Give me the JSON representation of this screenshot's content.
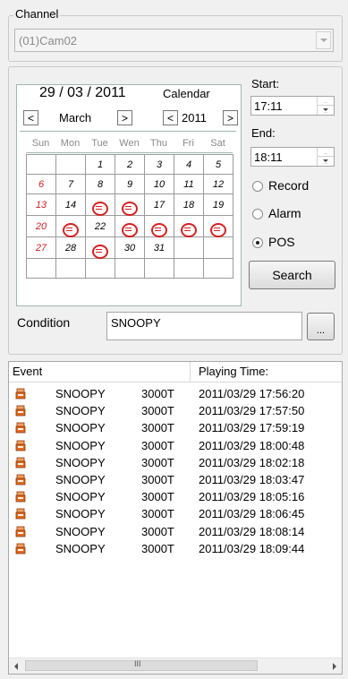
{
  "channel": {
    "legend": "Channel",
    "selected": "(01)Cam02"
  },
  "calendar": {
    "date_display": "29 / 03 / 2011",
    "calendar_label": "Calendar",
    "prev_month": "<",
    "next_month": ">",
    "month": "March",
    "prev_year": "<",
    "year": "2011",
    "next_year": ">",
    "weekdays": [
      "Sun",
      "Mon",
      "Tue",
      "Wen",
      "Thu",
      "Fri",
      "Sat"
    ],
    "weeks": [
      [
        "",
        "",
        "1",
        "2",
        "3",
        "4",
        "5"
      ],
      [
        "6",
        "7",
        "8",
        "9",
        "10",
        "11",
        "12"
      ],
      [
        "13",
        "14",
        "15",
        "16",
        "17",
        "18",
        "19"
      ],
      [
        "20",
        "21",
        "22",
        "23",
        "24",
        "25",
        "26"
      ],
      [
        "27",
        "28",
        "29",
        "30",
        "31",
        "",
        ""
      ],
      [
        "",
        "",
        "",
        "",
        "",
        "",
        ""
      ]
    ],
    "recorded_days": [
      "15",
      "16",
      "21",
      "23",
      "24",
      "25",
      "26",
      "29"
    ]
  },
  "time": {
    "start_label": "Start:",
    "start_value": "17:11",
    "end_label": "End:",
    "end_value": "18:11"
  },
  "filter": {
    "record_label": "Record",
    "alarm_label": "Alarm",
    "pos_label": "POS",
    "selected": "POS"
  },
  "search_button": "Search",
  "condition": {
    "label": "Condition",
    "value": "SNOOPY",
    "browse_label": "..."
  },
  "events": {
    "columns": [
      "Event",
      "Playing Time:"
    ],
    "rows": [
      {
        "name": "SNOOPY",
        "device": "3000T",
        "time": "2011/03/29 17:56:20"
      },
      {
        "name": "SNOOPY",
        "device": "3000T",
        "time": "2011/03/29 17:57:50"
      },
      {
        "name": "SNOOPY",
        "device": "3000T",
        "time": "2011/03/29 17:59:19"
      },
      {
        "name": "SNOOPY",
        "device": "3000T",
        "time": "2011/03/29 18:00:48"
      },
      {
        "name": "SNOOPY",
        "device": "3000T",
        "time": "2011/03/29 18:02:18"
      },
      {
        "name": "SNOOPY",
        "device": "3000T",
        "time": "2011/03/29 18:03:47"
      },
      {
        "name": "SNOOPY",
        "device": "3000T",
        "time": "2011/03/29 18:05:16"
      },
      {
        "name": "SNOOPY",
        "device": "3000T",
        "time": "2011/03/29 18:06:45"
      },
      {
        "name": "SNOOPY",
        "device": "3000T",
        "time": "2011/03/29 18:08:14"
      },
      {
        "name": "SNOOPY",
        "device": "3000T",
        "time": "2011/03/29 18:09:44"
      }
    ],
    "scroll_thumb": "III"
  },
  "colors": {
    "weekend_red": "#cc2020",
    "record_mark": "#d42020",
    "event_icon": "#e06a20"
  }
}
